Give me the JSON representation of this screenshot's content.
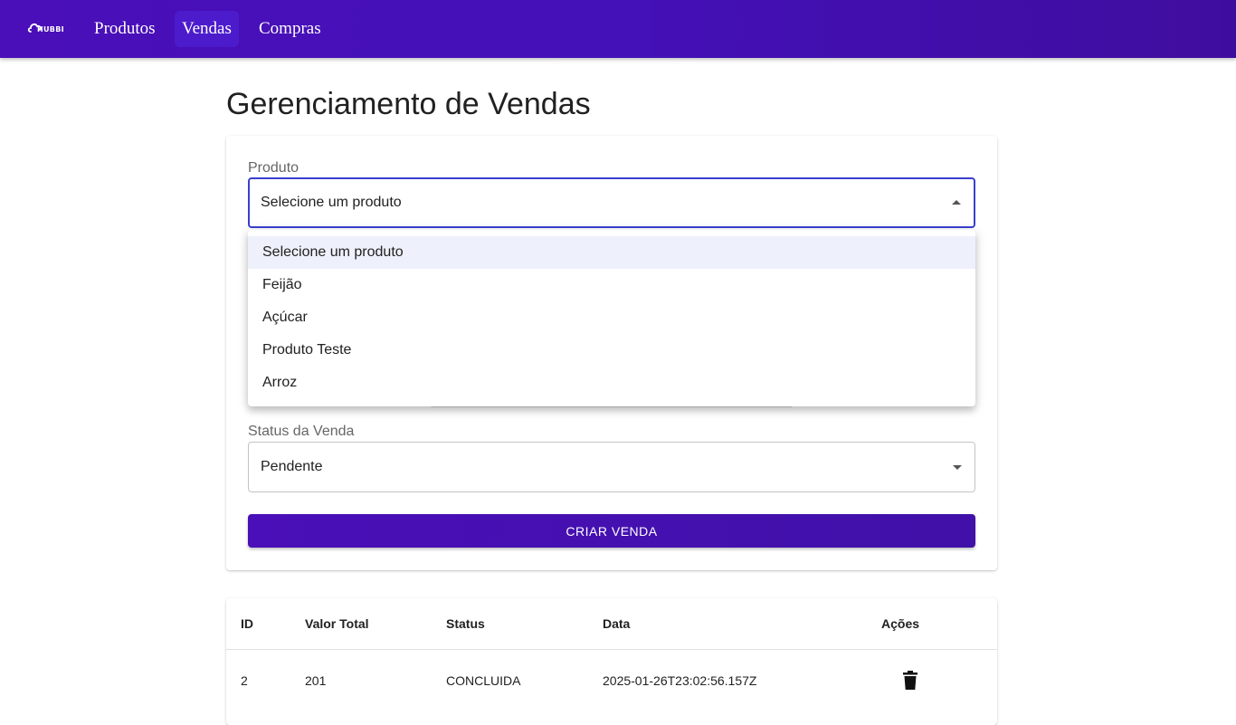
{
  "navbar": {
    "logo_text": "HUBBI",
    "items": [
      {
        "label": "Produtos",
        "active": false
      },
      {
        "label": "Vendas",
        "active": true
      },
      {
        "label": "Compras",
        "active": false
      }
    ]
  },
  "page": {
    "title": "Gerenciamento de Vendas"
  },
  "form": {
    "product_label": "Produto",
    "product_value": "Selecione um produto",
    "status_label": "Status da Venda",
    "status_value": "Pendente",
    "submit_label": "CRIAR VENDA"
  },
  "product_menu": {
    "options": [
      {
        "label": "Selecione um produto",
        "selected": true
      },
      {
        "label": "Feijão",
        "selected": false
      },
      {
        "label": "Açúcar",
        "selected": false
      },
      {
        "label": "Produto Teste",
        "selected": false
      },
      {
        "label": "Arroz",
        "selected": false
      }
    ]
  },
  "table": {
    "headers": [
      "ID",
      "Valor Total",
      "Status",
      "Data",
      "Ações"
    ],
    "rows": [
      {
        "id": "2",
        "total": "201",
        "status": "CONCLUIDA",
        "date": "2025-01-26T23:02:56.157Z",
        "action_icon": "trash-icon"
      }
    ]
  },
  "colors": {
    "primary": "#4a0fb8",
    "focus_border": "#3a3fd0",
    "selected_option": "#eef0fb"
  }
}
